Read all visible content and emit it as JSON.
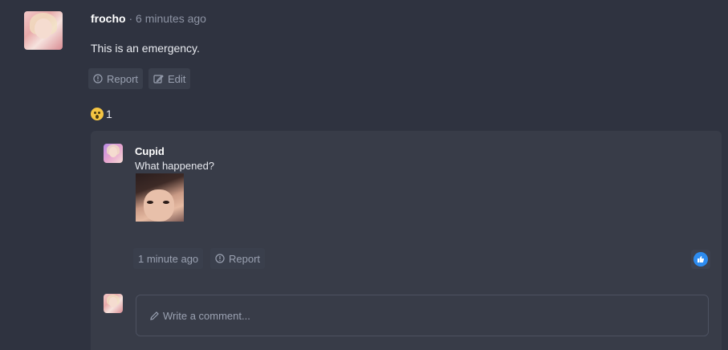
{
  "post": {
    "author": "frocho",
    "separator": " · ",
    "time": "6 minutes ago",
    "body": "This is an emergency.",
    "actions": {
      "report": "Report",
      "edit": "Edit"
    },
    "reaction": {
      "emoji": "flushed-face",
      "count": "1"
    }
  },
  "reply": {
    "author": "Cupid",
    "body": "What happened?",
    "time": "1 minute ago",
    "report": "Report"
  },
  "comment": {
    "placeholder": "Write a comment..."
  },
  "colors": {
    "background": "#2f3340",
    "card": "#383c48",
    "button": "#3a3f4c",
    "like": "#2d8cf0"
  }
}
